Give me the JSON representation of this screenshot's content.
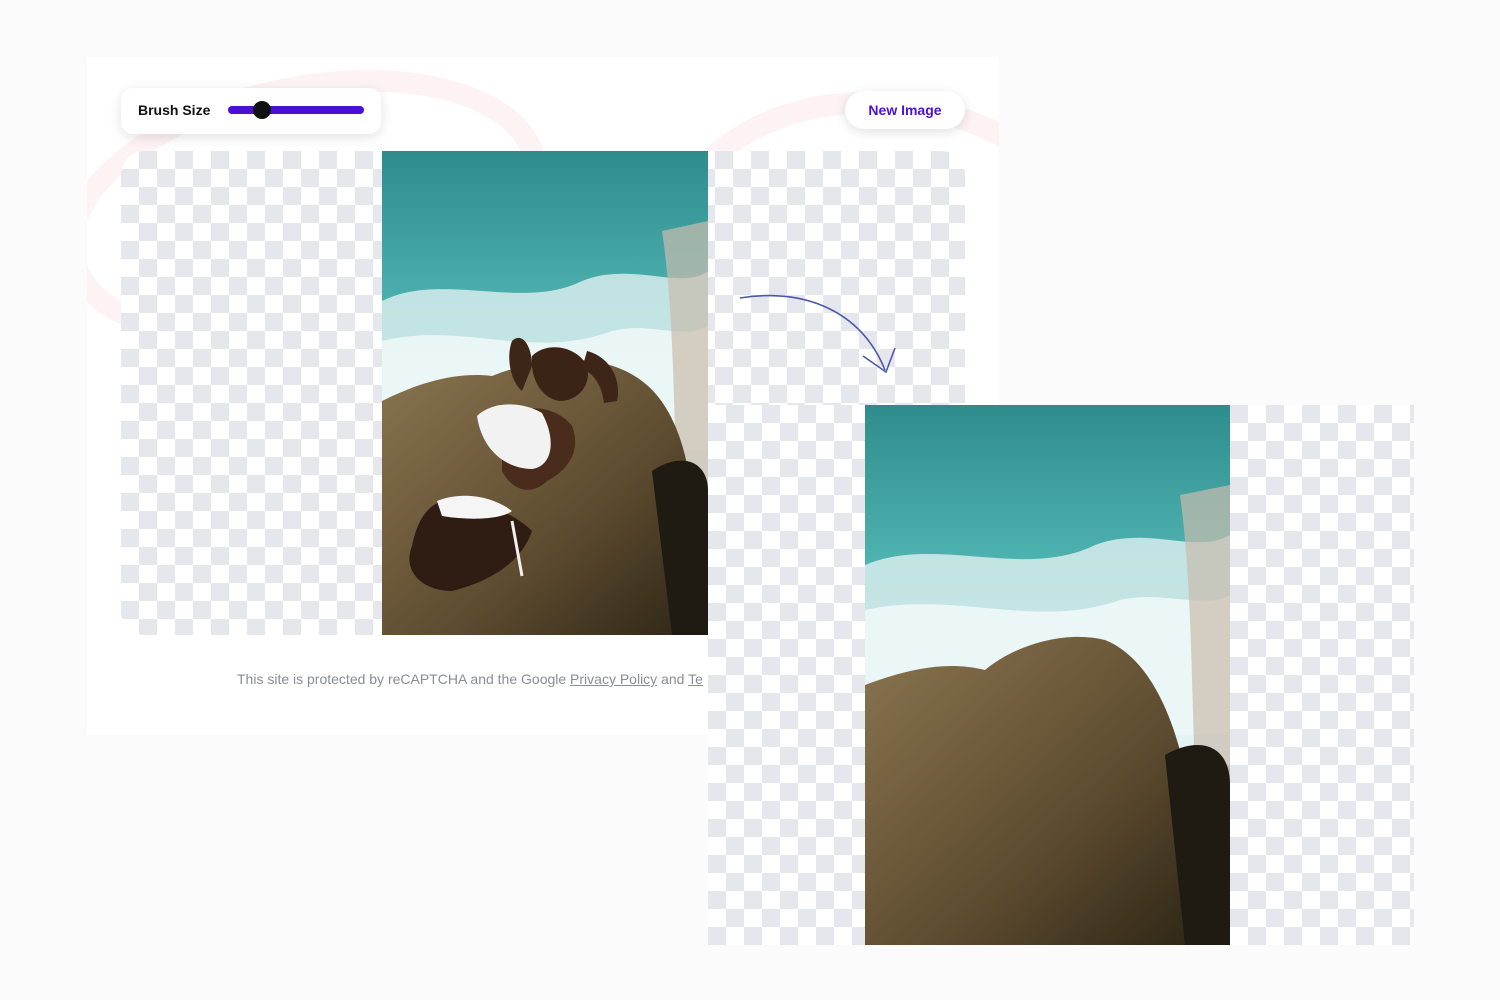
{
  "toolbar": {
    "brush_label": "Brush Size",
    "brush_size_fraction": 0.25,
    "new_image_label": "New Image",
    "accent_color": "#4a10d4"
  },
  "footer": {
    "text_before": "This site is protected by reCAPTCHA and the Google ",
    "privacy_link": "Privacy Policy",
    "text_and": " and ",
    "terms_link_visible": "Te"
  },
  "icons": {
    "transition_arrow": "curved-arrow-icon"
  }
}
